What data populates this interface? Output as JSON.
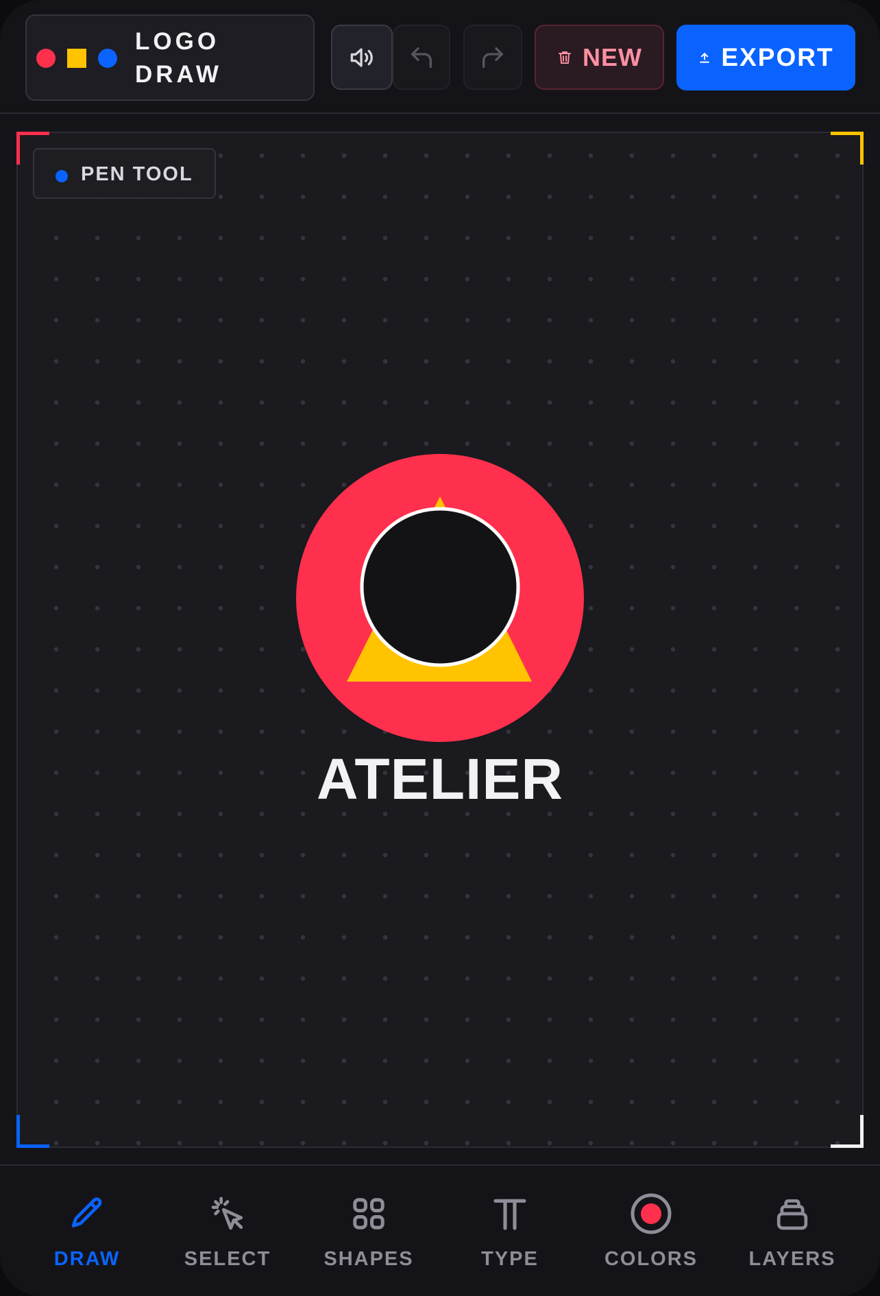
{
  "header": {
    "app_title": "LOGO DRAW",
    "brand_icons": [
      "red-circle-icon",
      "yellow-square-icon",
      "blue-circle-icon"
    ],
    "buttons": {
      "sound": {
        "icon": "speaker-icon"
      },
      "undo": {
        "icon": "undo-icon"
      },
      "redo": {
        "icon": "redo-icon"
      },
      "new": {
        "label": "NEW",
        "icon": "trash-icon"
      },
      "export": {
        "label": "EXPORT",
        "icon": "upload-icon"
      }
    }
  },
  "canvas": {
    "active_tool": "PEN TOOL",
    "logo": {
      "text": "ATELIER",
      "colors": {
        "outer_circle": "#ff304d",
        "triangle": "#ffc300",
        "inner_circle": "#131316",
        "inner_ring": "#ffffff"
      }
    },
    "corner_colors": {
      "top_left": "#ff304d",
      "top_right": "#ffc300",
      "bottom_left": "#0a63ff",
      "bottom_right": "#f2f2f4"
    }
  },
  "bottom_nav": {
    "active": "DRAW",
    "items": [
      {
        "label": "DRAW",
        "icon": "pencil-icon"
      },
      {
        "label": "SELECT",
        "icon": "cursor-click-icon"
      },
      {
        "label": "SHAPES",
        "icon": "shapes-grid-icon"
      },
      {
        "label": "TYPE",
        "icon": "type-icon"
      },
      {
        "label": "COLORS",
        "icon": "color-swatch-icon"
      },
      {
        "label": "LAYERS",
        "icon": "layers-icon"
      }
    ]
  },
  "theme": {
    "accent": "#0a63ff",
    "red": "#ff304d",
    "yellow": "#ffc300",
    "background": "#151519"
  }
}
